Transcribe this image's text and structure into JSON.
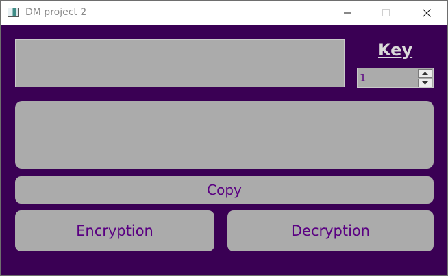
{
  "window": {
    "title": "DM project 2",
    "background_color": "#3a0054",
    "controls": [
      "minimize-icon",
      "maximize-icon",
      "close-icon"
    ]
  },
  "input_text": {
    "value": ""
  },
  "key": {
    "label": "Key",
    "value": "1"
  },
  "output_text": {
    "value": ""
  },
  "buttons": {
    "copy": "Copy",
    "encryption": "Encryption",
    "decryption": "Decryption"
  },
  "colors": {
    "widget_gray": "#ababab",
    "button_text": "#5a0082",
    "key_label": "#d9d9d9"
  }
}
